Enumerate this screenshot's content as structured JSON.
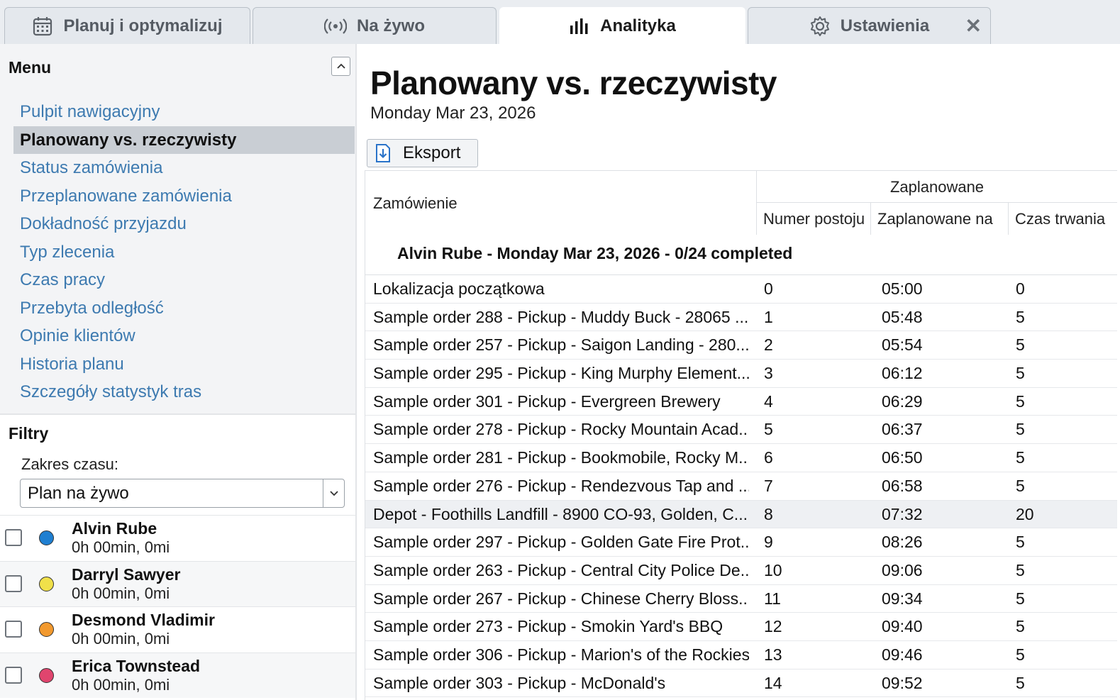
{
  "tabs": [
    {
      "label": "Planuj i optymalizuj",
      "icon": "calendar-icon"
    },
    {
      "label": "Na żywo",
      "icon": "broadcast-icon"
    },
    {
      "label": "Analityka",
      "icon": "bar-chart-icon",
      "active": true
    },
    {
      "label": "Ustawienia",
      "icon": "gear-icon"
    }
  ],
  "sidebar": {
    "menu_title": "Menu",
    "items": [
      {
        "label": "Pulpit nawigacyjny"
      },
      {
        "label": "Planowany vs. rzeczywisty",
        "active": true
      },
      {
        "label": "Status zamówienia"
      },
      {
        "label": "Przeplanowane zamówienia"
      },
      {
        "label": "Dokładność przyjazdu"
      },
      {
        "label": "Typ zlecenia"
      },
      {
        "label": "Czas pracy"
      },
      {
        "label": "Przebyta odległość"
      },
      {
        "label": "Opinie klientów"
      },
      {
        "label": "Historia planu"
      },
      {
        "label": "Szczegóły statystyk tras"
      }
    ],
    "filters_title": "Filtry",
    "time_range_label": "Zakres czasu:",
    "time_range_value": "Plan na żywo",
    "drivers": [
      {
        "name": "Alvin Rube",
        "stats": "0h 00min, 0mi",
        "color": "#1f7fd1"
      },
      {
        "name": "Darryl Sawyer",
        "stats": "0h 00min, 0mi",
        "color": "#f0e04a"
      },
      {
        "name": "Desmond Vladimir",
        "stats": "0h 00min, 0mi",
        "color": "#f2992e"
      },
      {
        "name": "Erica Townstead",
        "stats": "0h 00min, 0mi",
        "color": "#e0456e"
      }
    ]
  },
  "main": {
    "title": "Planowany vs. rzeczywisty",
    "date": "Monday Mar 23, 2026",
    "export_label": "Eksport",
    "table": {
      "order_header": "Zamówienie",
      "group_header": "Zaplanowane",
      "sub_headers": [
        "Numer postoju",
        "Zaplanowane na",
        "Czas trwania"
      ],
      "group_label": "Alvin Rube - Monday Mar 23, 2026 - 0/24 completed",
      "rows": [
        {
          "order": "Lokalizacja początkowa",
          "stop": "0",
          "time": "05:00",
          "duration": "0"
        },
        {
          "order": "Sample order 288 - Pickup - Muddy Buck - 28065 ...",
          "stop": "1",
          "time": "05:48",
          "duration": "5"
        },
        {
          "order": "Sample order 257 - Pickup - Saigon Landing - 280...",
          "stop": "2",
          "time": "05:54",
          "duration": "5"
        },
        {
          "order": "Sample order 295 - Pickup - King Murphy Element...",
          "stop": "3",
          "time": "06:12",
          "duration": "5"
        },
        {
          "order": "Sample order 301 - Pickup - Evergreen Brewery",
          "stop": "4",
          "time": "06:29",
          "duration": "5"
        },
        {
          "order": "Sample order 278 - Pickup - Rocky Mountain Acad...",
          "stop": "5",
          "time": "06:37",
          "duration": "5"
        },
        {
          "order": "Sample order 281 - Pickup - Bookmobile, Rocky M...",
          "stop": "6",
          "time": "06:50",
          "duration": "5"
        },
        {
          "order": "Sample order 276 - Pickup - Rendezvous Tap and ...",
          "stop": "7",
          "time": "06:58",
          "duration": "5"
        },
        {
          "order": "Depot - Foothills Landfill - 8900 CO-93, Golden, C...",
          "stop": "8",
          "time": "07:32",
          "duration": "20",
          "highlight": true
        },
        {
          "order": "Sample order 297 - Pickup - Golden Gate Fire Prot...",
          "stop": "9",
          "time": "08:26",
          "duration": "5"
        },
        {
          "order": "Sample order 263 - Pickup - Central City Police De...",
          "stop": "10",
          "time": "09:06",
          "duration": "5"
        },
        {
          "order": "Sample order 267 - Pickup - Chinese Cherry Bloss...",
          "stop": "11",
          "time": "09:34",
          "duration": "5"
        },
        {
          "order": "Sample order 273 - Pickup - Smokin Yard's BBQ",
          "stop": "12",
          "time": "09:40",
          "duration": "5"
        },
        {
          "order": "Sample order 306 - Pickup - Marion's of the Rockies",
          "stop": "13",
          "time": "09:46",
          "duration": "5"
        },
        {
          "order": "Sample order 303 - Pickup - McDonald's",
          "stop": "14",
          "time": "09:52",
          "duration": "5"
        }
      ]
    }
  }
}
